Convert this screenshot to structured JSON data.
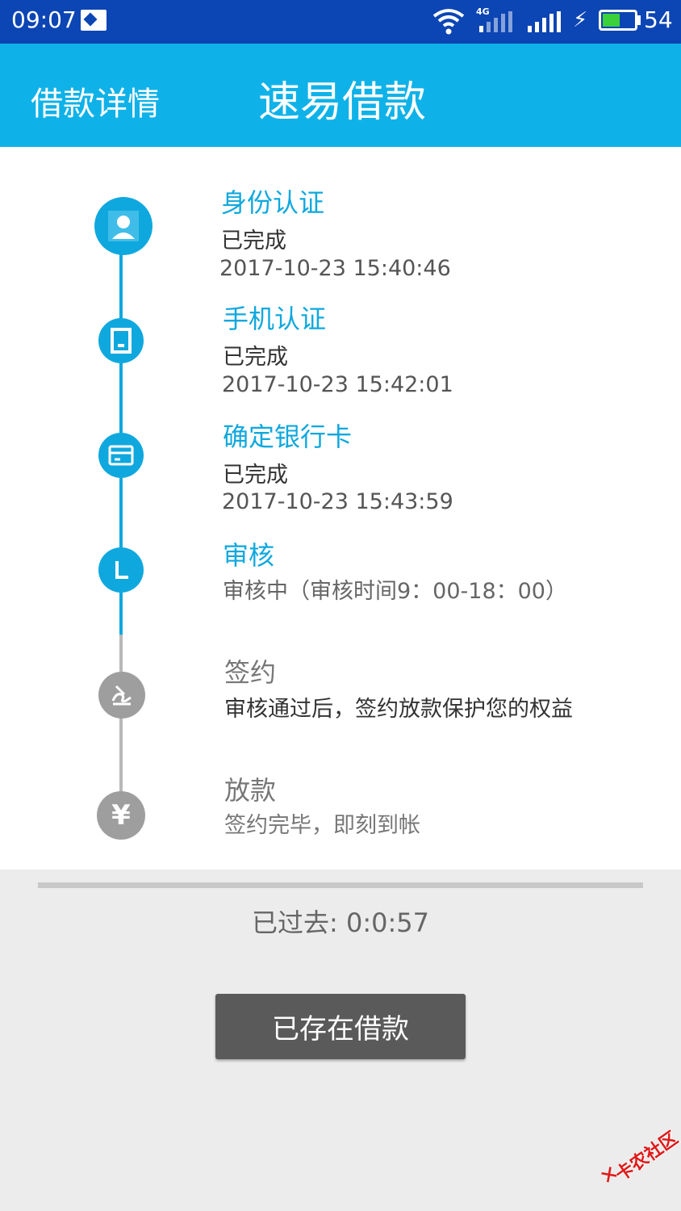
{
  "status_bar": {
    "time": "09:07",
    "network_label": "4G",
    "battery_level": "54",
    "battery_fraction": 0.54,
    "icons": [
      "image-icon",
      "wifi-icon",
      "signal-icon",
      "charging-icon",
      "battery-icon"
    ]
  },
  "app_bar": {
    "back_label": "借款详情",
    "title": "速易借款"
  },
  "steps": [
    {
      "title": "身份认证",
      "status": "已完成",
      "time": "2017-10-23 15:40:46",
      "state": "done",
      "icon": "user-icon"
    },
    {
      "title": "手机认证",
      "status": "已完成",
      "time": "2017-10-23 15:42:01",
      "state": "done",
      "icon": "phone-icon"
    },
    {
      "title": "确定银行卡",
      "status": "已完成",
      "time": "2017-10-23 15:43:59",
      "state": "done",
      "icon": "bank-card-icon"
    },
    {
      "title": "审核",
      "status": "审核中（审核时间9：00-18：00）",
      "state": "in-progress",
      "icon": "clock-icon"
    },
    {
      "title": "签约",
      "status": "审核通过后，签约放款保护您的权益",
      "state": "pending",
      "icon": "sign-icon"
    },
    {
      "title": "放款",
      "status": "签约完毕，即刻到帐",
      "state": "pending",
      "icon": "yen-icon"
    }
  ],
  "elapsed_text": "已过去: 0:0:57",
  "main_button_label": "已存在借款",
  "watermark_text": "卡农社区",
  "colors": {
    "status_bar": "#0c45b4",
    "app_bar": "#0fb2e8",
    "accent": "#0fa8de",
    "pending": "#a8a8a8",
    "button": "#5a5a5a",
    "background": "#ececec"
  }
}
